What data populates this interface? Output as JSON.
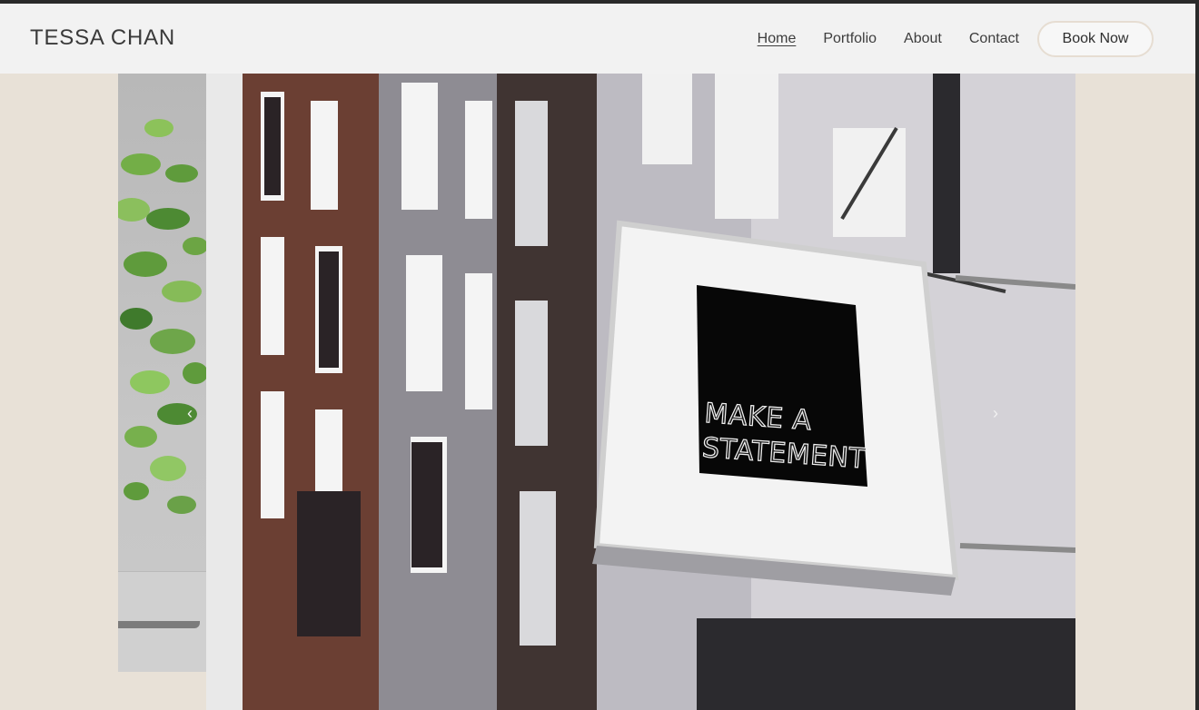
{
  "header": {
    "brand": "TESSA CHAN",
    "nav": [
      {
        "label": "Home",
        "active": true
      },
      {
        "label": "Portfolio"
      },
      {
        "label": "About"
      },
      {
        "label": "Contact"
      }
    ],
    "cta": "Book Now"
  },
  "hero": {
    "sign_text_line1": "MAKE A",
    "sign_text_line2": "STATEMENT",
    "prev_arrow": "chevron-left-icon",
    "next_arrow": "chevron-right-icon"
  },
  "colors": {
    "page_background": "#e8e1d7",
    "header_background": "#f2f2f2",
    "cta_border": "#e6ddd2"
  }
}
